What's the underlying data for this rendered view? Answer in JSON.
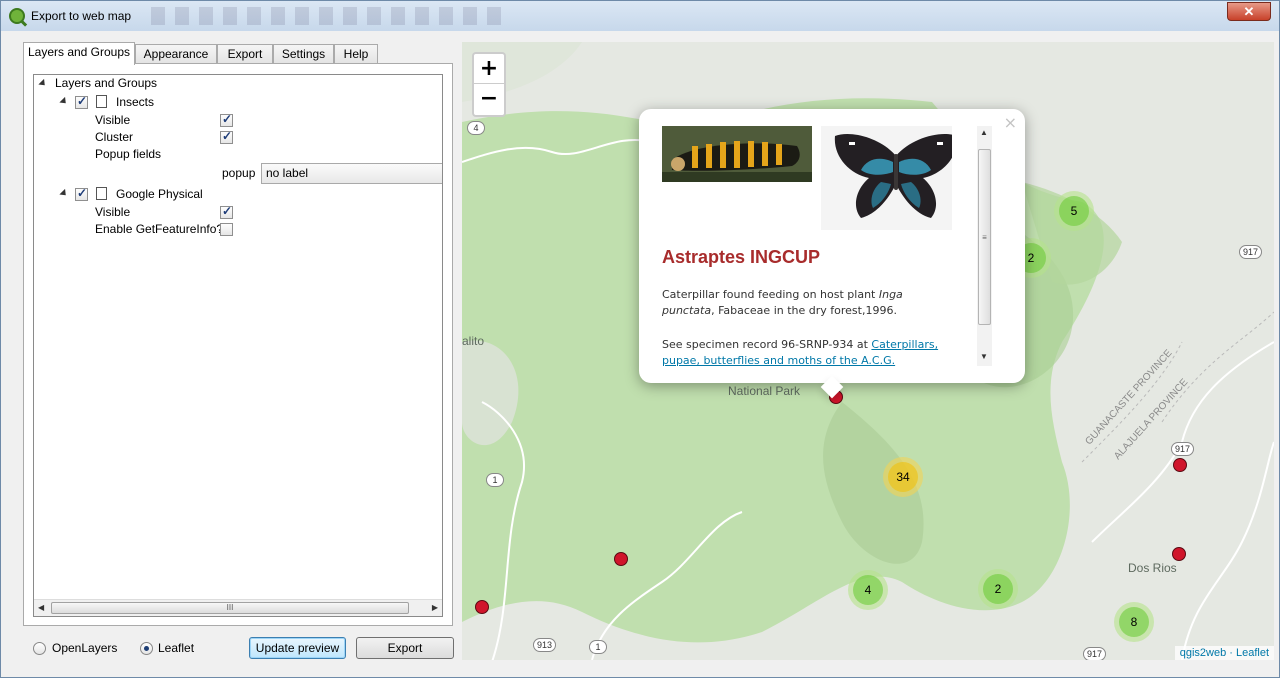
{
  "window": {
    "title": "Export to web map",
    "close_label": "✕"
  },
  "tabs": [
    "Layers and Groups",
    "Appearance",
    "Export",
    "Settings",
    "Help"
  ],
  "tree": {
    "root_label": "Layers and Groups",
    "layers": [
      {
        "name": "Insects",
        "checked": true,
        "props": [
          {
            "label": "Visible",
            "checked": true
          },
          {
            "label": "Cluster",
            "checked": true
          }
        ],
        "popup_fields_label": "Popup fields",
        "popup_field_name": "popup",
        "popup_field_value": "no label"
      },
      {
        "name": "Google Physical",
        "checked": true,
        "props": [
          {
            "label": "Visible",
            "checked": true
          },
          {
            "label": "Enable GetFeatureInfo?",
            "checked": false
          }
        ]
      }
    ],
    "scroll_grip": "III"
  },
  "bottom": {
    "radio_openlayers": "OpenLayers",
    "radio_leaflet": "Leaflet",
    "selected_radio": "Leaflet",
    "update_label": "Update preview",
    "export_label": "Export"
  },
  "map": {
    "zoom_in": "+",
    "zoom_out": "−",
    "clusters": [
      "5",
      "2",
      "34",
      "4",
      "2",
      "8"
    ],
    "labels": {
      "alito": "alito",
      "national_park": "National Park",
      "dos_rios": "Dos Rios",
      "guanacaste": "GUANACASTE PROVINCE",
      "alajuela": "ALAJUELA PROVINCE"
    },
    "shields": [
      "4",
      "917",
      "917",
      "1",
      "913",
      "1",
      "917"
    ],
    "attribution": "qgis2web · Leaflet"
  },
  "popup": {
    "close": "×",
    "title": "Astraptes INGCUP",
    "text1_before": "Caterpillar found feeding on host plant ",
    "text1_italic": "Inga punctata",
    "text1_after": ", Fabaceae in the dry forest,1996.",
    "text2_before": "See specimen record 96-SRNP-934 at ",
    "link_text": "Caterpillars, pupae, butterflies and moths of the A.C.G.",
    "scroll_grip": "≡"
  },
  "colors": {
    "popup_title": "#a82c2c",
    "link": "#0078a8",
    "map_green": "#bfdca6",
    "marker": "#d0152b"
  }
}
